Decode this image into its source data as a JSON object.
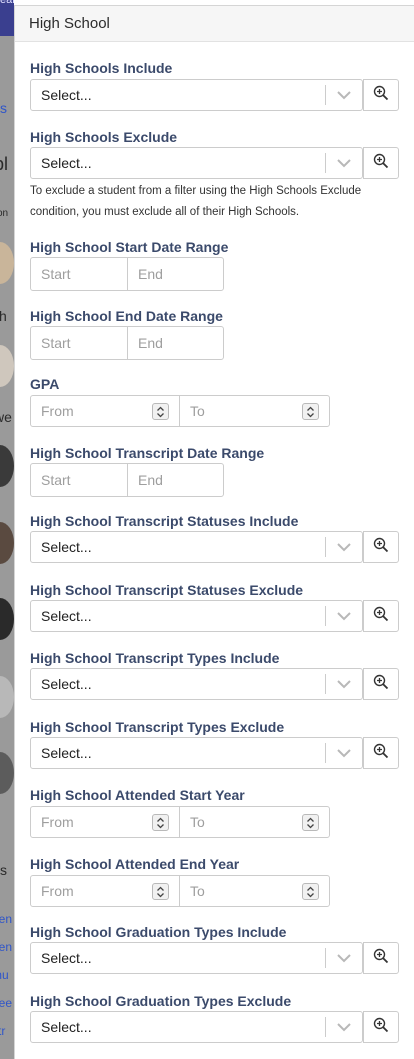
{
  "panel": {
    "title": "High School"
  },
  "background": {
    "fragments": [
      "earc",
      "s",
      "pl",
      "son",
      "ch",
      "we",
      "s",
      "nen",
      "nen",
      "mu",
      "nee",
      "str"
    ]
  },
  "fields": {
    "hs_include": {
      "label": "High Schools Include",
      "placeholder": "Select..."
    },
    "hs_exclude": {
      "label": "High Schools Exclude",
      "placeholder": "Select...",
      "help": "To exclude a student from a filter using the High Schools Exclude condition, you must exclude all of their High Schools."
    },
    "start_date": {
      "label": "High School Start Date Range",
      "start": "Start",
      "end": "End"
    },
    "end_date": {
      "label": "High School End Date Range",
      "start": "Start",
      "end": "End"
    },
    "gpa": {
      "label": "GPA",
      "from": "From",
      "to": "To"
    },
    "transcript_date": {
      "label": "High School Transcript Date Range",
      "start": "Start",
      "end": "End"
    },
    "transcript_status_include": {
      "label": "High School Transcript Statuses Include",
      "placeholder": "Select..."
    },
    "transcript_status_exclude": {
      "label": "High School Transcript Statuses Exclude",
      "placeholder": "Select..."
    },
    "transcript_type_include": {
      "label": "High School Transcript Types Include",
      "placeholder": "Select..."
    },
    "transcript_type_exclude": {
      "label": "High School Transcript Types Exclude",
      "placeholder": "Select..."
    },
    "attended_start": {
      "label": "High School Attended Start Year",
      "from": "From",
      "to": "To"
    },
    "attended_end": {
      "label": "High School Attended End Year",
      "from": "From",
      "to": "To"
    },
    "grad_type_include": {
      "label": "High School Graduation Types Include",
      "placeholder": "Select..."
    },
    "grad_type_exclude": {
      "label": "High School Graduation Types Exclude",
      "placeholder": "Select..."
    }
  },
  "icons": {
    "dropdown": "chevron-down-icon",
    "lookup": "zoom-in-icon",
    "spinner": "spinner-arrows-icon"
  },
  "colors": {
    "label": "#3b4a6b",
    "border": "#cccccc",
    "nav": "#3a3f8f",
    "link": "#2f55c9"
  }
}
